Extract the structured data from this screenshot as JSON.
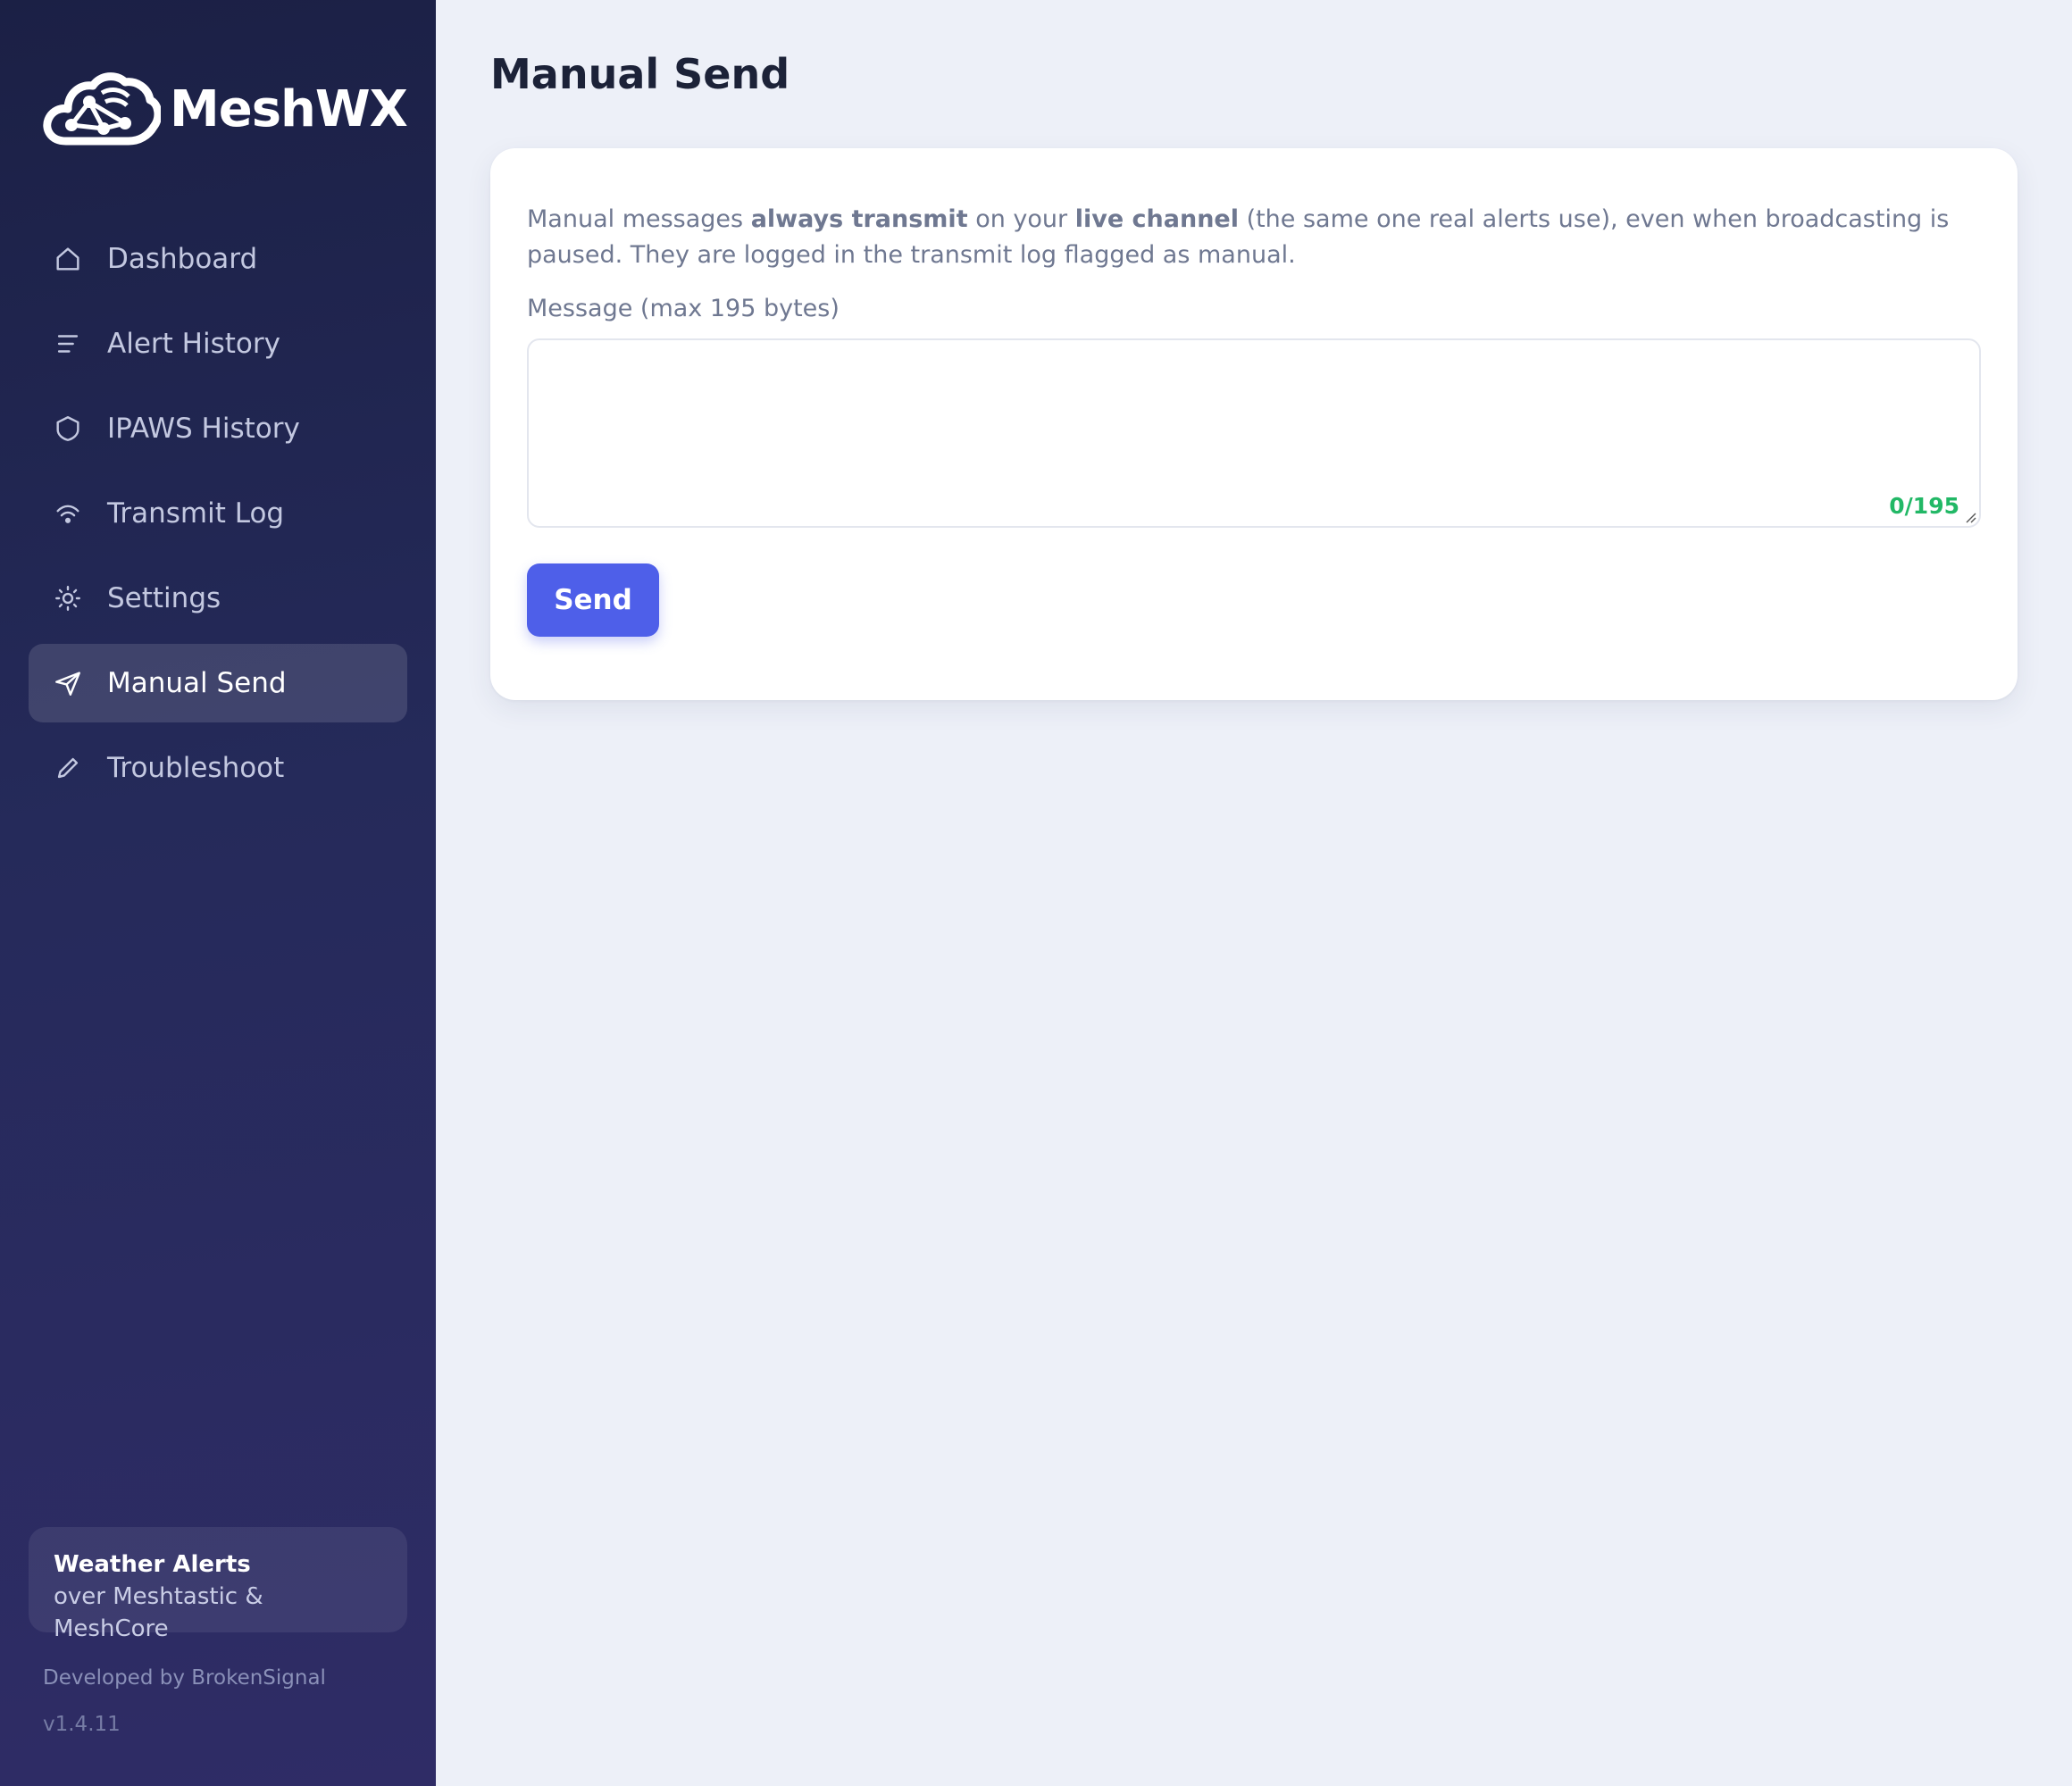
{
  "app": {
    "logo_text": "MeshWX",
    "logo_icon": "cloud-mesh-network-icon"
  },
  "sidebar": {
    "items": [
      {
        "label": "Dashboard",
        "icon": "home-icon",
        "active": false
      },
      {
        "label": "Alert History",
        "icon": "list-icon",
        "active": false
      },
      {
        "label": "IPAWS History",
        "icon": "shield-icon",
        "active": false
      },
      {
        "label": "Transmit Log",
        "icon": "wifi-icon",
        "active": false
      },
      {
        "label": "Settings",
        "icon": "sun-gear-icon",
        "active": false
      },
      {
        "label": "Manual Send",
        "icon": "send-icon",
        "active": true
      },
      {
        "label": "Troubleshoot",
        "icon": "pencil-icon",
        "active": false
      }
    ],
    "tagline": {
      "title": "Weather Alerts",
      "subtitle": "over Meshtastic & MeshCore"
    },
    "developer": "Developed by BrokenSignal",
    "version": "v1.4.11"
  },
  "main": {
    "title": "Manual Send",
    "description": {
      "part1": "Manual messages ",
      "bold1": "always transmit",
      "part2": " on your ",
      "bold2": "live channel",
      "part3": " (the same one real alerts use), even when broadcasting is paused. They are logged in the transmit log flagged as manual."
    },
    "message_label": "Message (max 195 bytes)",
    "message_value": "",
    "char_count": "0/195",
    "send_label": "Send"
  },
  "colors": {
    "accent": "#4e5fe9",
    "count_ok": "#22b866",
    "sidebar_top": "#1b2045",
    "sidebar_bottom": "#2f2c66",
    "background": "#edf0f8"
  }
}
